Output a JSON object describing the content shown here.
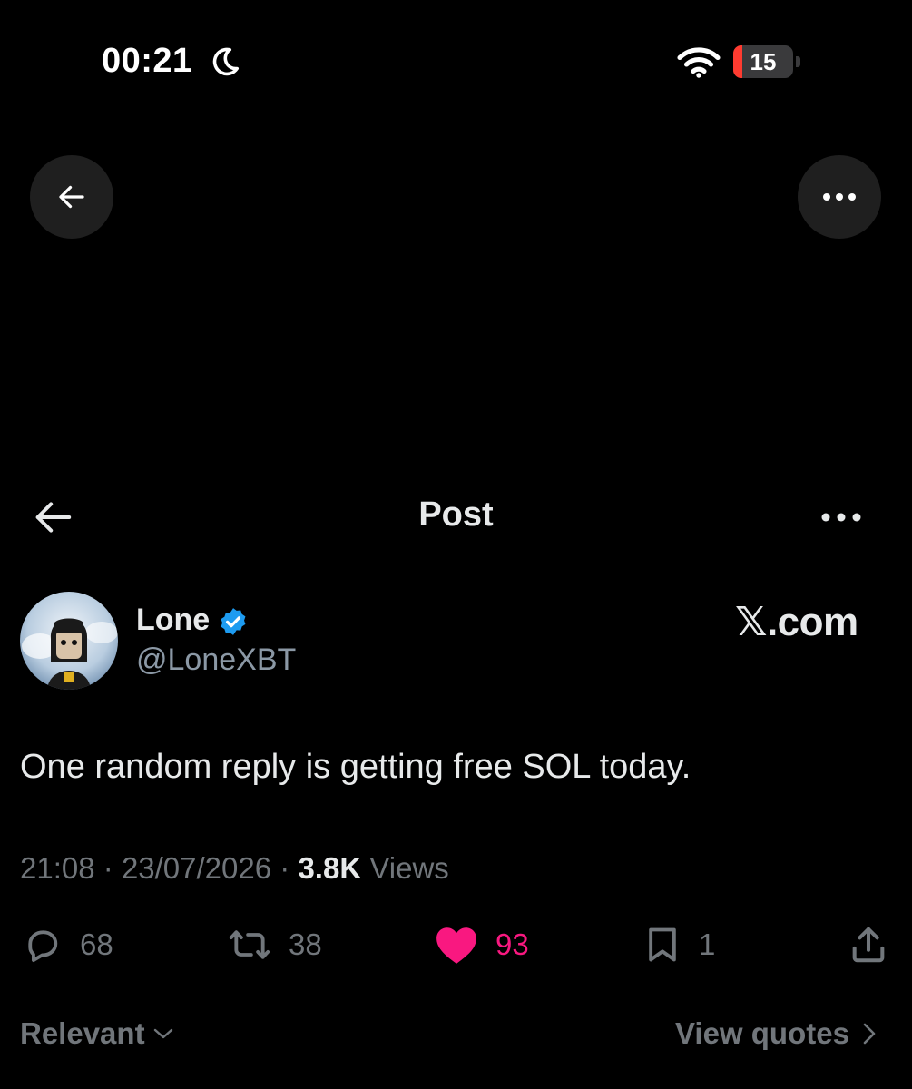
{
  "status_bar": {
    "time": "00:21",
    "battery_level": "15",
    "icons": [
      "moon-icon",
      "wifi-icon",
      "battery-icon"
    ],
    "battery_color": "#ff3b30"
  },
  "overlay": {
    "back_icon": "arrow-left-icon",
    "more_icon": "more-horizontal-icon"
  },
  "header": {
    "title": "Post",
    "back_icon": "arrow-left-icon",
    "more_icon": "more-horizontal-icon"
  },
  "post": {
    "author_name": "Lone",
    "author_handle": "@LoneXBT",
    "verified": true,
    "verified_color": "#1d9bf0",
    "watermark": "𝕏.com",
    "text": "One random reply is getting free SOL today.",
    "time": "21:08",
    "date": "23/07/2026",
    "views_count": "3.8K",
    "views_label": "Views",
    "separator": "·"
  },
  "actions": {
    "replies": "68",
    "reposts": "38",
    "likes": "93",
    "bookmarks": "1",
    "liked": true,
    "like_color": "#f91880"
  },
  "footer": {
    "sort_label": "Relevant",
    "quotes_label": "View quotes"
  }
}
